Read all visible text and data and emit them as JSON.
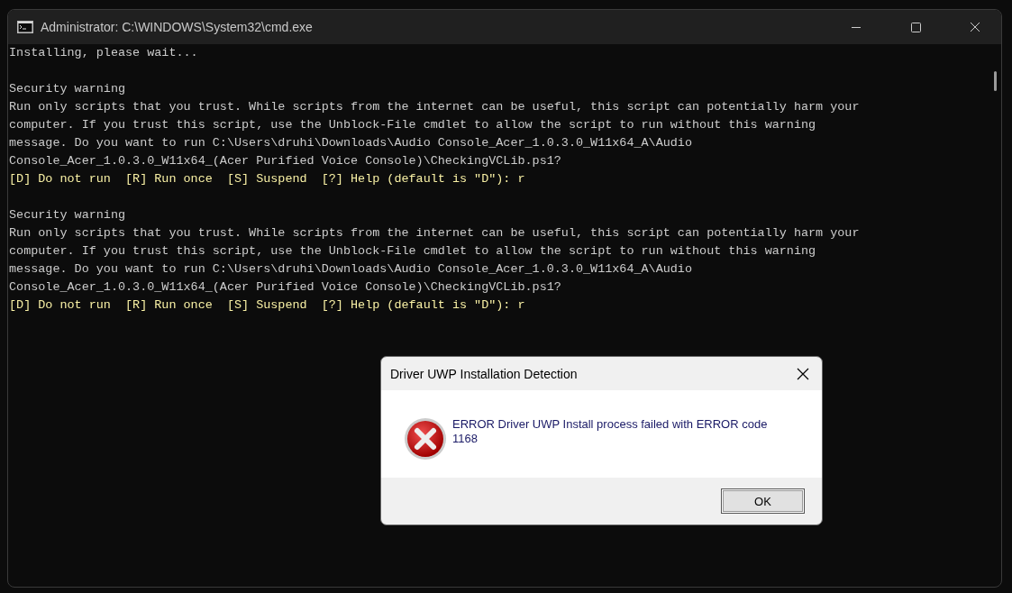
{
  "window": {
    "title": "Administrator: C:\\WINDOWS\\System32\\cmd.exe"
  },
  "console": {
    "lines": [
      {
        "kind": "output",
        "text": "Installing, please wait..."
      },
      {
        "kind": "blank"
      },
      {
        "kind": "output",
        "text": "Security warning"
      },
      {
        "kind": "output",
        "text": "Run only scripts that you trust. While scripts from the internet can be useful, this script can potentially harm your"
      },
      {
        "kind": "output",
        "text": "computer. If you trust this script, use the Unblock-File cmdlet to allow the script to run without this warning"
      },
      {
        "kind": "output",
        "text": "message. Do you want to run C:\\Users\\druhi\\Downloads\\Audio Console_Acer_1.0.3.0_W11x64_A\\Audio"
      },
      {
        "kind": "output",
        "text": "Console_Acer_1.0.3.0_W11x64_(Acer Purified Voice Console)\\CheckingVCLib.ps1?"
      },
      {
        "kind": "prompt",
        "text": "[D] Do not run  [R] Run once  [S] Suspend  [?] Help (default is \"D\"): r"
      },
      {
        "kind": "blank"
      },
      {
        "kind": "output",
        "text": "Security warning"
      },
      {
        "kind": "output",
        "text": "Run only scripts that you trust. While scripts from the internet can be useful, this script can potentially harm your"
      },
      {
        "kind": "output",
        "text": "computer. If you trust this script, use the Unblock-File cmdlet to allow the script to run without this warning"
      },
      {
        "kind": "output",
        "text": "message. Do you want to run C:\\Users\\druhi\\Downloads\\Audio Console_Acer_1.0.3.0_W11x64_A\\Audio"
      },
      {
        "kind": "output",
        "text": "Console_Acer_1.0.3.0_W11x64_(Acer Purified Voice Console)\\CheckingVCLib.ps1?"
      },
      {
        "kind": "prompt",
        "text": "[D] Do not run  [R] Run once  [S] Suspend  [?] Help (default is \"D\"): r"
      }
    ]
  },
  "dialog": {
    "title": "Driver UWP Installation Detection",
    "message": "ERROR Driver UWP Install process failed with ERROR code 1168",
    "buttons": [
      "OK"
    ]
  }
}
